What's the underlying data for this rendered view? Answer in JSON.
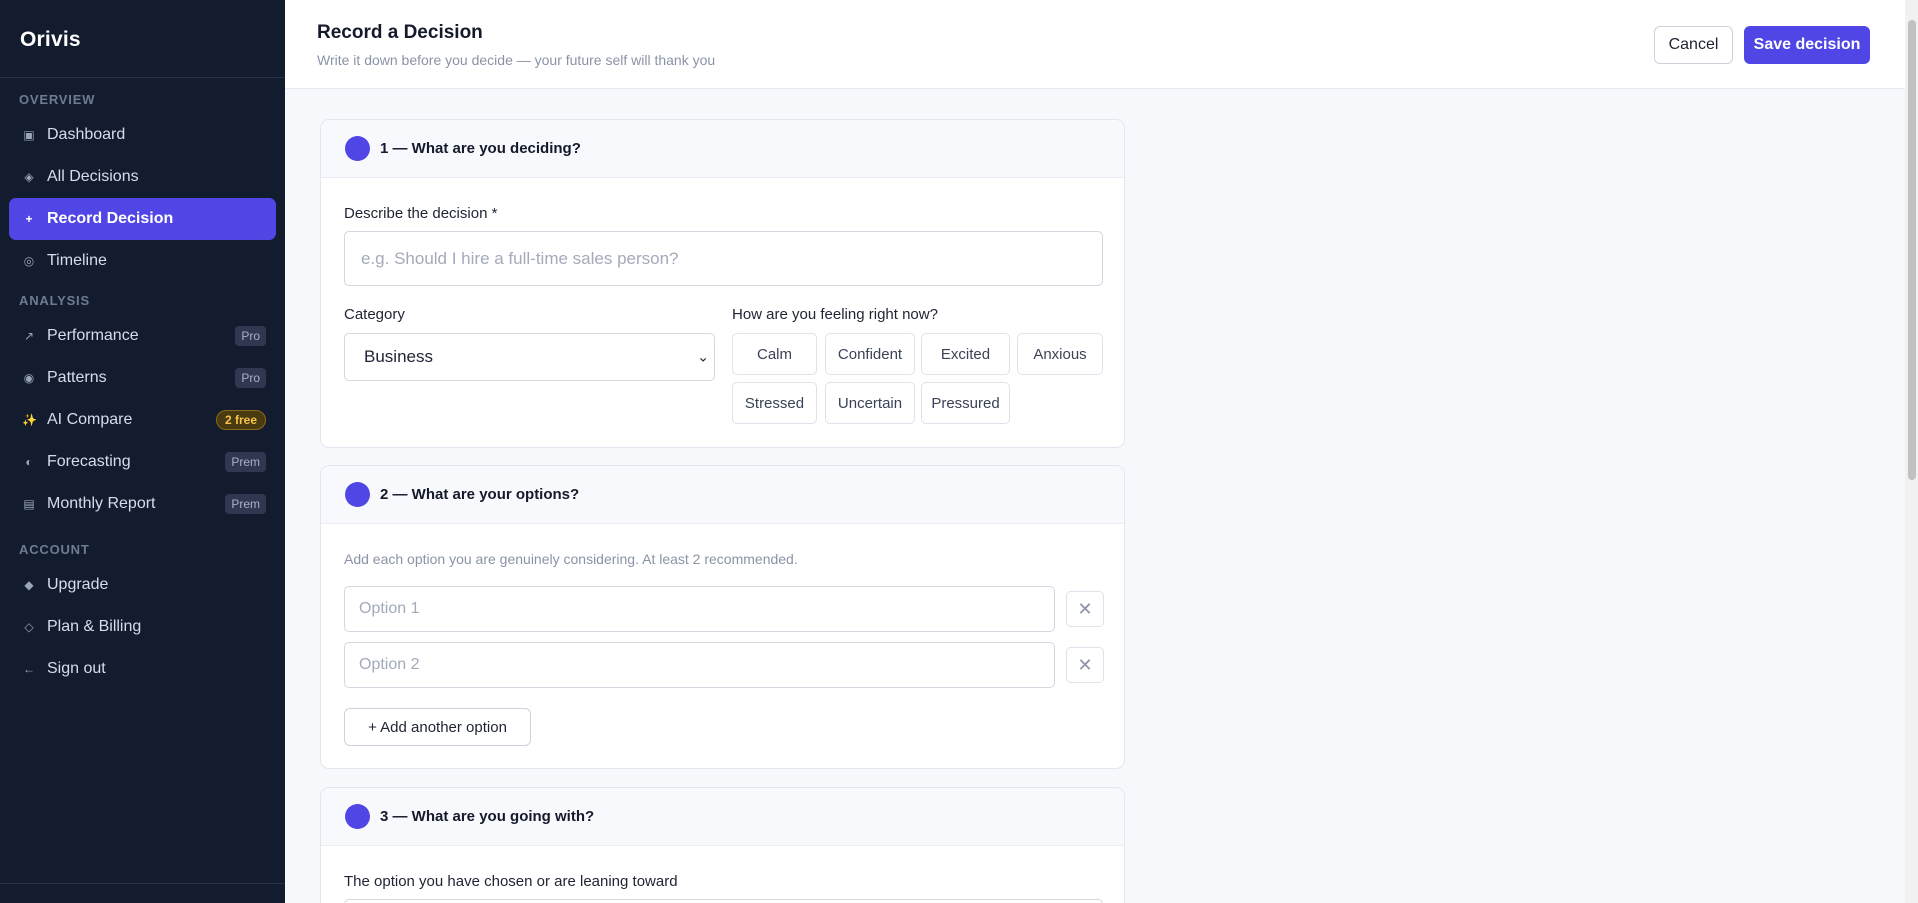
{
  "app": {
    "brand": "Orivis"
  },
  "sidebar": {
    "sections": [
      {
        "label": "OVERVIEW",
        "items": [
          {
            "label": "Dashboard",
            "icon": "grid-icon",
            "glyph": "▣"
          },
          {
            "label": "All Decisions",
            "icon": "diamond-icon",
            "glyph": "◈"
          },
          {
            "label": "Record Decision",
            "icon": "plus-icon",
            "glyph": "+",
            "active": true
          },
          {
            "label": "Timeline",
            "icon": "target-icon",
            "glyph": "◎"
          }
        ]
      },
      {
        "label": "ANALYSIS",
        "items": [
          {
            "label": "Performance",
            "icon": "trend-icon",
            "glyph": "↗",
            "tag": "Pro"
          },
          {
            "label": "Patterns",
            "icon": "radio-icon",
            "glyph": "◉",
            "tag": "Pro"
          },
          {
            "label": "AI Compare",
            "icon": "sparkles-icon",
            "glyph": "✨",
            "tag": "2 free",
            "tag_style": "amber"
          },
          {
            "label": "Forecasting",
            "icon": "half-circle-icon",
            "glyph": "◐",
            "tag": "Prem"
          },
          {
            "label": "Monthly Report",
            "icon": "report-icon",
            "glyph": "▤",
            "tag": "Prem"
          }
        ]
      },
      {
        "label": "ACCOUNT",
        "items": [
          {
            "label": "Upgrade",
            "icon": "diamond-filled-icon",
            "glyph": "◆"
          },
          {
            "label": "Plan & Billing",
            "icon": "diamond-outline-icon",
            "glyph": "◇"
          },
          {
            "label": "Sign out",
            "icon": "arrow-left-icon",
            "glyph": "←"
          }
        ]
      }
    ]
  },
  "header": {
    "title": "Record a Decision",
    "subtitle": "Write it down before you decide — your future self will thank you",
    "cancel_label": "Cancel",
    "save_label": "Save decision"
  },
  "step1": {
    "title": "1 — What are you deciding?",
    "describe_label": "Describe the decision *",
    "describe_placeholder": "e.g. Should I hire a full-time sales person?",
    "category_label": "Category",
    "category_value": "Business",
    "feeling_label": "How are you feeling right now?",
    "feelings": [
      "Calm",
      "Confident",
      "Excited",
      "Anxious",
      "Stressed",
      "Uncertain",
      "Pressured"
    ]
  },
  "step2": {
    "title": "2 — What are your options?",
    "hint": "Add each option you are genuinely considering. At least 2 recommended.",
    "options": [
      {
        "placeholder": "Option 1"
      },
      {
        "placeholder": "Option 2"
      }
    ],
    "add_label": "+ Add another option"
  },
  "step3": {
    "title": "3 — What are you going with?",
    "chosen_label": "The option you have chosen or are leaning toward"
  },
  "colors": {
    "accent": "#4f46e5",
    "sidebar_bg": "#131c2e",
    "amber_tag": "#f5c44a"
  }
}
